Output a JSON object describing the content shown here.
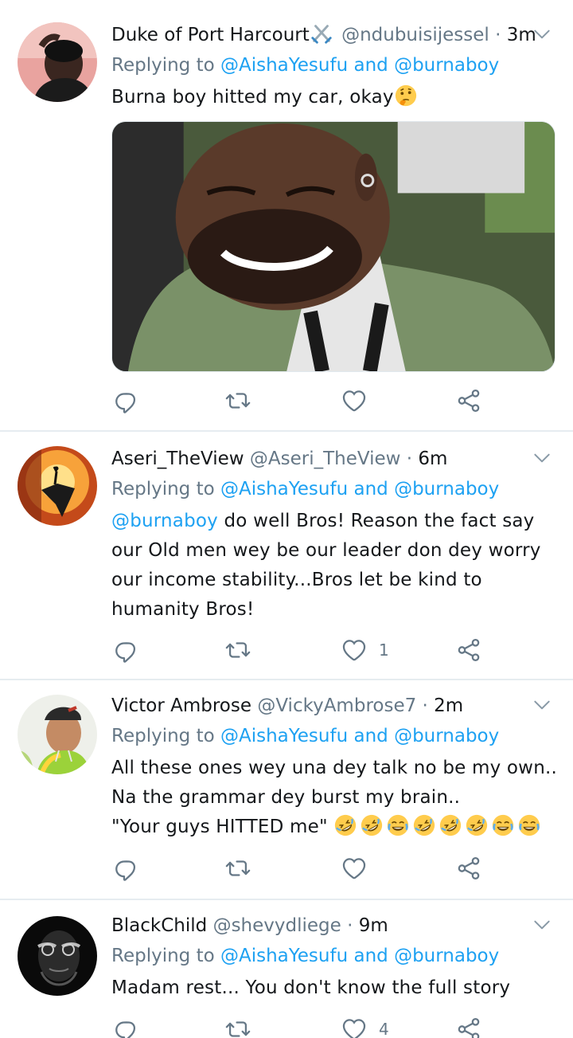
{
  "tweets": [
    {
      "name": "Duke of Port Harcourt",
      "name_emoji": "crossed-swords-icon",
      "handle": "@ndubuisijessel",
      "dot": "·",
      "time": "3m",
      "reply_prefix": "Replying to",
      "reply_user1": "@AishaYesufu",
      "reply_and": "and",
      "reply_user2": "@burnaboy",
      "text": "Burna boy hitted my car, okay",
      "text_emoji": "thinking-face-icon",
      "has_media": true,
      "like_count": "",
      "avatar": "avatar-young-man"
    },
    {
      "name": "Aseri_TheView",
      "handle": "@Aseri_TheView",
      "dot": "·",
      "time": "6m",
      "reply_prefix": "Replying to",
      "reply_user1": "@AishaYesufu",
      "reply_and": "and",
      "reply_user2": "@burnaboy",
      "text_mention": "@burnaboy",
      "text": "do well Bros! Reason the fact say our Old men wey be our leader don dey worry our income stability...Bros let be kind to humanity Bros!",
      "like_count": "1",
      "avatar": "avatar-cliff-silhouette"
    },
    {
      "name": "Victor Ambrose",
      "handle": "@VickyAmbrose7",
      "dot": "·",
      "time": "2m",
      "reply_prefix": "Replying to",
      "reply_user1": "@AishaYesufu",
      "reply_and": "and",
      "reply_user2": "@burnaboy",
      "text_line1": "All these ones wey una dey talk no be my own..",
      "text_line2": "Na the grammar dey burst my brain..",
      "text_line3": "\"Your guys HITTED me\"",
      "text_emojis": [
        "rofl-icon",
        "rofl-icon",
        "tears-of-joy-icon",
        "rofl-icon",
        "rofl-icon",
        "rofl-icon",
        "tears-of-joy-icon",
        "tears-of-joy-icon"
      ],
      "like_count": "",
      "avatar": "avatar-cap-man"
    },
    {
      "name": "BlackChild",
      "handle": "@shevydliege",
      "dot": "·",
      "time": "9m",
      "reply_prefix": "Replying to",
      "reply_user1": "@AishaYesufu",
      "reply_and": "and",
      "reply_user2": "@burnaboy",
      "text": "Madam rest... You don't know the full story",
      "like_count": "4",
      "avatar": "avatar-dark-portrait"
    }
  ],
  "colors": {
    "link": "#1da1f2",
    "muted": "#657786",
    "text": "#14171a",
    "divider": "#e6ecf0"
  }
}
